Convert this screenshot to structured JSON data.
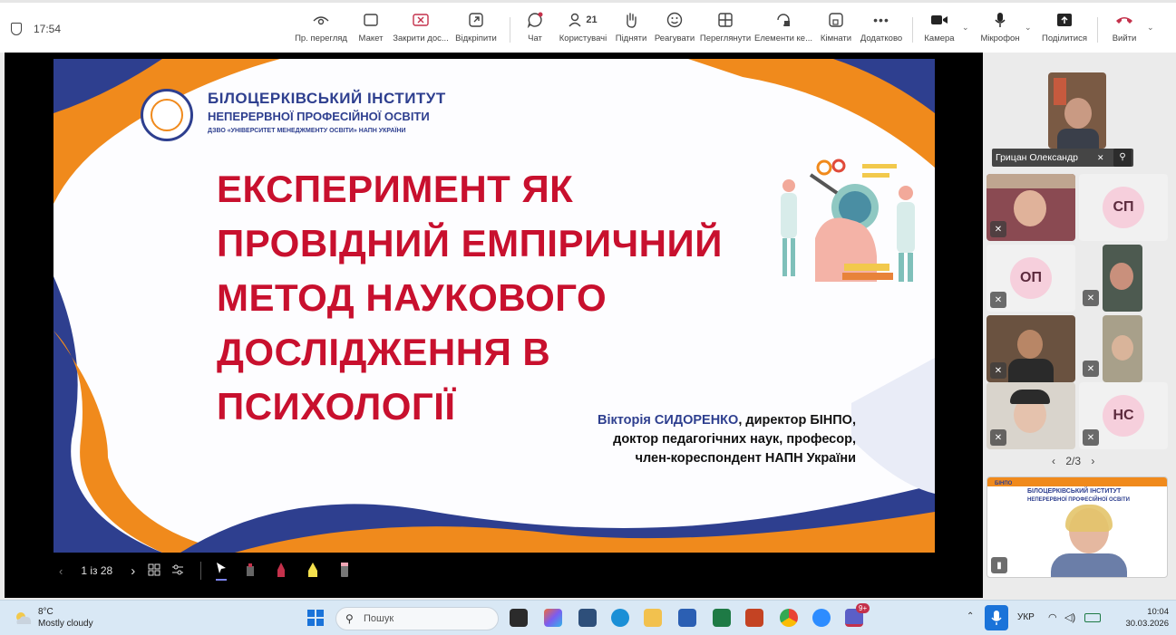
{
  "topbar": {
    "time": "17:54",
    "buttons": [
      {
        "icon": "eye-icon",
        "label": "Пр. перегляд"
      },
      {
        "icon": "layout-icon",
        "label": "Макет"
      },
      {
        "icon": "close-share-icon",
        "label": "Закрити дос..."
      },
      {
        "icon": "popout-icon",
        "label": "Відкріпити"
      },
      {
        "icon": "chat-icon",
        "label": "Чат"
      },
      {
        "icon": "people-icon",
        "label": "Користувачі",
        "count": "21"
      },
      {
        "icon": "raise-hand-icon",
        "label": "Підняти"
      },
      {
        "icon": "react-icon",
        "label": "Реагувати"
      },
      {
        "icon": "view-icon",
        "label": "Переглянути"
      },
      {
        "icon": "apps-icon",
        "label": "Елементи ке..."
      },
      {
        "icon": "rooms-icon",
        "label": "Кімнати"
      },
      {
        "icon": "more-icon",
        "label": "Додатково"
      },
      {
        "icon": "camera-icon",
        "label": "Камера"
      },
      {
        "icon": "microphone-icon",
        "label": "Мікрофон"
      },
      {
        "icon": "share-icon",
        "label": "Поділитися"
      },
      {
        "icon": "hangup-icon",
        "label": "Вийти"
      }
    ]
  },
  "slide": {
    "institute_line1": "БІЛОЦЕРКІВСЬКИЙ ІНСТИТУТ",
    "institute_line2": "НЕПЕРЕРВНОЇ ПРОФЕСІЙНОЇ ОСВІТИ",
    "institute_line3": "ДЗВО «УНІВЕРСИТЕТ МЕНЕДЖМЕНТУ ОСВІТИ» НАПН УКРАЇНИ",
    "title": "ЕКСПЕРИМЕНТ ЯК ПРОВІДНИЙ ЕМПІРИЧНИЙ МЕТОД НАУКОВОГО ДОСЛІДЖЕННЯ В ПСИХОЛОГІЇ",
    "author_name": "Вікторія СИДОРЕНКО",
    "author_line1_rest": ", директор БІНПО,",
    "author_line2": "доктор педагогічних наук, професор,",
    "author_line3": "член-кореспондент НАПН України",
    "colors": {
      "title": "#c8102e",
      "brand": "#2e3f8f",
      "accent": "#f08a1c"
    }
  },
  "slide_controls": {
    "page": "1 із 28"
  },
  "participants": {
    "featured_name": "Грицан Олександр",
    "tiles": [
      {
        "initials": "СП"
      },
      {
        "initials": "ОП"
      },
      {
        "initials": "НС"
      }
    ],
    "pager": "2/3",
    "presenter_line1": "БІЛОЦЕРКІВСЬКИЙ ІНСТИТУТ",
    "presenter_line2": "НЕПЕРЕРВНОЇ ПРОФЕСІЙНОЇ ОСВІТИ",
    "presenter_small": "БІНПО"
  },
  "taskbar": {
    "temp": "8°C",
    "weather": "Mostly cloudy",
    "search_placeholder": "Пошук",
    "lang": "УКР",
    "clock_time": "10:04",
    "clock_date": "30.03.2026",
    "badge": "9+"
  }
}
